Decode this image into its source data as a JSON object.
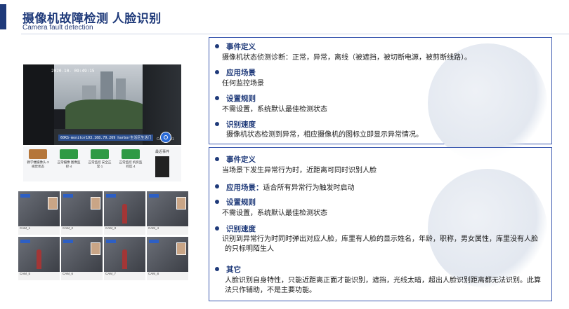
{
  "header": {
    "title": "摄像机故障检测 人脸识别",
    "subtitle": "Camera fault detection"
  },
  "camera_view": {
    "timestamp": "2020-10-",
    "timestamp_extra": "09:49:15",
    "ip_overlay": "60KS-monitor193.168.79.269 harbor生活区生活门",
    "camera_label": "Camera 01"
  },
  "devices": [
    {
      "label": "教学楼摄像头·3 视觉状态",
      "color": "#b5763a"
    },
    {
      "label": "正常摄像 图像监控·4",
      "color": "#2f9a45"
    },
    {
      "label": "正常监控 安全正常·1",
      "color": "#2f9a45"
    },
    {
      "label": "正常监控 机房监控区·4",
      "color": "#2f9a45"
    }
  ],
  "device_side_title": "最近事件",
  "thumbnails": [
    {
      "caption": "CAM_1"
    },
    {
      "caption": "CAM_2"
    },
    {
      "caption": "CAM_3"
    },
    {
      "caption": "CAM_4"
    },
    {
      "caption": "CAM_5"
    },
    {
      "caption": "CAM_6"
    },
    {
      "caption": "CAM_7"
    },
    {
      "caption": "CAM_8"
    }
  ],
  "box_top": {
    "items": [
      {
        "head": "事件定义",
        "body": "摄像机状态侦测诊断：正常，异常，离线（被遮挡，被切断电源，被剪断线路）。"
      },
      {
        "head": "应用场景",
        "body": "任何监控场景"
      },
      {
        "head": "设置规则",
        "body": "不需设置，系统默认最佳检测状态"
      },
      {
        "head": "识别速度",
        "body": "摄像机状态检测到异常，相应摄像机的图标立即显示异常情况。"
      }
    ]
  },
  "box_bottom": {
    "event_head": "事件定义",
    "event_body": "当场景下发生异常行为时，近距离可同时识别人脸",
    "scene_head": "应用场景：",
    "scene_body": "适合所有异常行为触发时启动",
    "rule_head": "设置规则",
    "rule_body": "不需设置，系统默认最佳检测状态",
    "speed_head": "识别速度",
    "speed_body": "识别到异常行为时同时弹出对应人脸，库里有人脸的显示姓名，年龄，职称，男女属性，库里没有人脸的只标明陌生人",
    "other_head": "其它",
    "other_body": "人脸识别自身特性，只能近距离正面才能识别，遮挡，光线太暗，超出人脸识别距离都无法识别。此算法只作辅助，不是主要功能。"
  }
}
